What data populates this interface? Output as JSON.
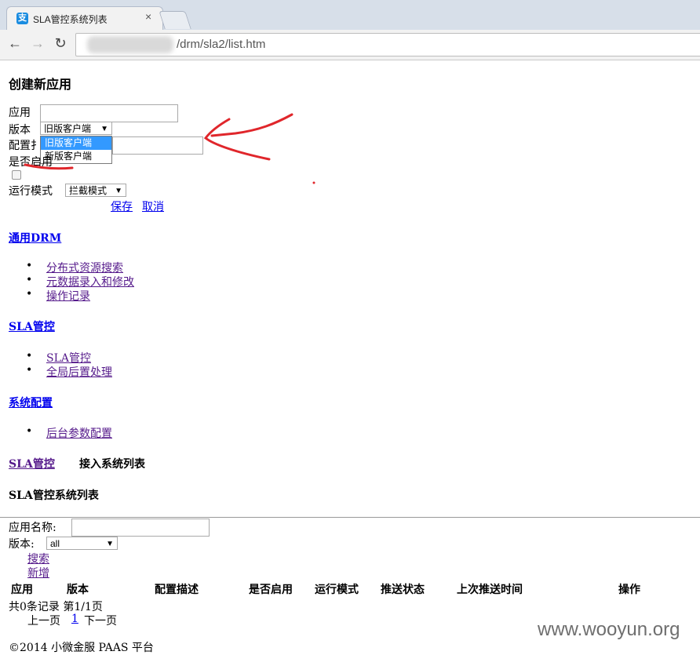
{
  "browser": {
    "tab_title": "SLA管控系统列表",
    "favicon_glyph": "支",
    "url": "/drm/sla2/list.htm"
  },
  "create_form": {
    "heading": "创建新应用",
    "app_label": "应用",
    "app_value": "",
    "version_label": "版本",
    "version_selected": "旧版客户端",
    "version_options": [
      "旧版客户端",
      "新版客户端"
    ],
    "config_label": "配置描述",
    "config_label_visible": "配置扌",
    "config_value": "",
    "enabled_label": "是否启用",
    "enabled_label_visible": "是否启用",
    "enabled_checked": false,
    "mode_label": "运行模式",
    "mode_selected": "拦截模式",
    "save": "保存",
    "cancel": "取消"
  },
  "nav": [
    {
      "title": "通用DRM",
      "items": [
        "分布式资源搜索",
        "元数据录入和修改",
        "操作记录"
      ]
    },
    {
      "title": "SLA管控",
      "items": [
        "SLA管控",
        "全局后置处理"
      ]
    },
    {
      "title": "系统配置",
      "items": [
        "后台参数配置"
      ]
    }
  ],
  "breadcrumb": {
    "link": "SLA管控",
    "current": "接入系统列表"
  },
  "list_title": "SLA管控系统列表",
  "search": {
    "app_name_label": "应用名称:",
    "app_name_value": "",
    "version_label": "版本:",
    "version_selected": "all",
    "search_link": "搜索",
    "add_link": "新增"
  },
  "table": {
    "headers": [
      "应用",
      "版本",
      "配置描述",
      "是否启用",
      "运行模式",
      "推送状态",
      "上次推送时间",
      "操作"
    ],
    "rows": []
  },
  "pagination": {
    "summary": "共0条记录 第1/1页",
    "prev": "上一页",
    "page": "1",
    "next": "下一页"
  },
  "footer": "©2014 小微金服 PAAS 平台",
  "watermark": "www.wooyun.org",
  "colors": {
    "annotation": "#e0262b",
    "dropdown_highlight": "#3399ff",
    "link": "#0000ee",
    "visited_link": "#551a8b"
  }
}
